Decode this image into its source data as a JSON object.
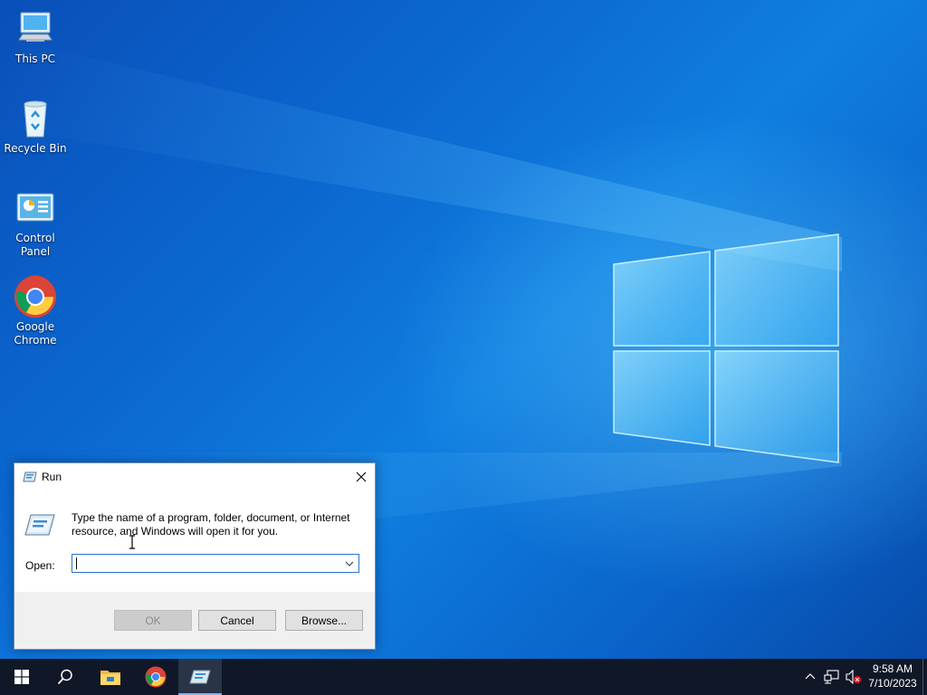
{
  "desktop": {
    "icons": [
      {
        "label": "This PC",
        "icon": "this-pc-icon"
      },
      {
        "label": "Recycle Bin",
        "icon": "recycle-bin-icon"
      },
      {
        "label": "Control Panel",
        "icon": "control-panel-icon"
      },
      {
        "label": "Google\nChrome",
        "label_line1": "Google",
        "label_line2": "Chrome",
        "icon": "chrome-icon"
      }
    ]
  },
  "run_dialog": {
    "title": "Run",
    "description": "Type the name of a program, folder, document, or Internet resource, and Windows will open it for you.",
    "open_label": "Open:",
    "open_value": "",
    "buttons": {
      "ok": "OK",
      "cancel": "Cancel",
      "browse": "Browse..."
    },
    "ok_disabled": true
  },
  "taskbar": {
    "items": [
      "start-icon",
      "search-icon",
      "file-explorer-icon",
      "chrome-icon",
      "run-icon"
    ],
    "active_item": "run-icon",
    "tray": [
      "chevron-up-icon",
      "network-icon",
      "volume-muted-icon"
    ],
    "time": "9:58 AM",
    "date": "7/10/2023"
  },
  "colors": {
    "taskbar": "#101827",
    "accent": "#2a73c9",
    "wallpaper": "#0b66cf"
  }
}
